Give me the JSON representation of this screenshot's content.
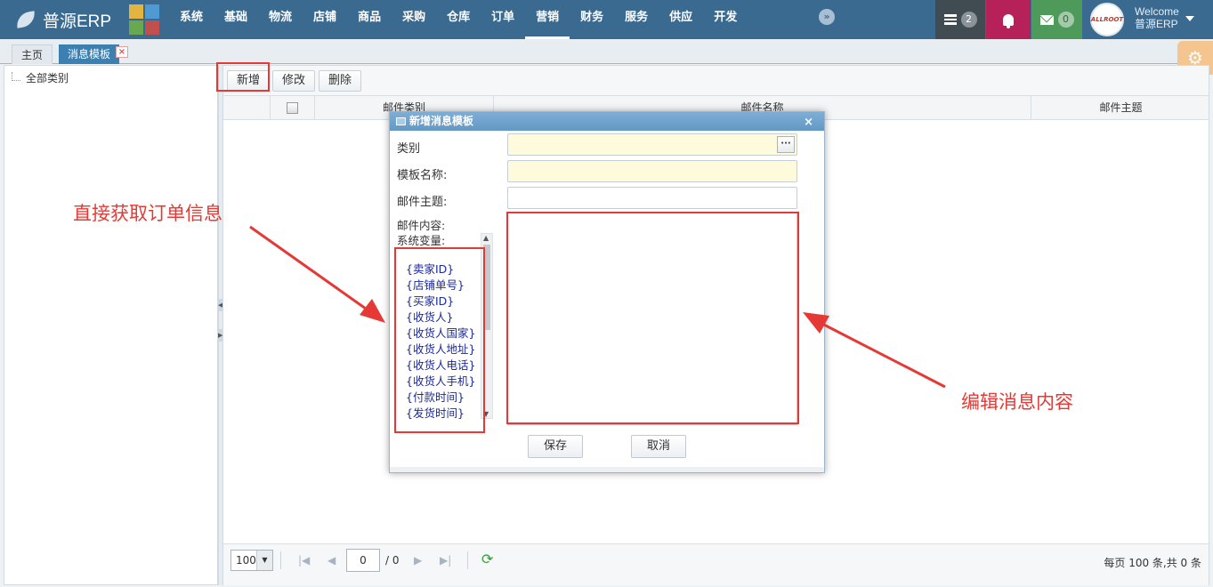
{
  "app": {
    "logo_text": "普源ERP",
    "logo_tile_colors": [
      "#e3b43f",
      "#4f9ad3",
      "#6aa84f",
      "#c0504d"
    ]
  },
  "nav": {
    "items": [
      "系统",
      "基础",
      "物流",
      "店铺",
      "商品",
      "采购",
      "仓库",
      "订单",
      "营销",
      "财务",
      "服务",
      "供应",
      "开发"
    ],
    "active": "营销",
    "more_icon": "double-chevron-right-icon"
  },
  "topbar": {
    "tasks_count": "2",
    "mail_count": "0",
    "tasks_bg": "#414b52",
    "bell_bg": "#b7215a",
    "mail_bg": "#4d9a5a",
    "welcome": "Welcome",
    "username": "普源ERP",
    "avatar_text": "ALLROOT"
  },
  "tabs": {
    "home": "主页",
    "current": "消息模板",
    "close": "×"
  },
  "tree": {
    "root": "全部类别"
  },
  "toolbar": {
    "add": "新增",
    "edit": "修改",
    "delete": "删除"
  },
  "grid": {
    "columns": [
      "邮件类别",
      "邮件名称",
      "邮件主题"
    ]
  },
  "pager": {
    "page_size": "100",
    "page_input": "0",
    "total_pages": "/ 0",
    "info": "每页 100 条,共 0 条"
  },
  "dialog": {
    "title": "新增消息模板",
    "close": "×",
    "fields": {
      "category": "类别",
      "name": "模板名称:",
      "subject": "邮件主题:",
      "content": "邮件内容:",
      "vars_label": "系统变量:"
    },
    "picker_button": "···",
    "variables": [
      "{卖家ID}",
      "{店铺单号}",
      "{买家ID}",
      "{收货人}",
      "{收货人国家}",
      "{收货人地址}",
      "{收货人电话}",
      "{收货人手机}",
      "{付款时间}",
      "{发货时间}"
    ],
    "save": "保存",
    "cancel": "取消"
  },
  "annotations": {
    "left_note": "直接获取订单信息",
    "right_note": "编辑消息内容",
    "color": "#e53935"
  }
}
